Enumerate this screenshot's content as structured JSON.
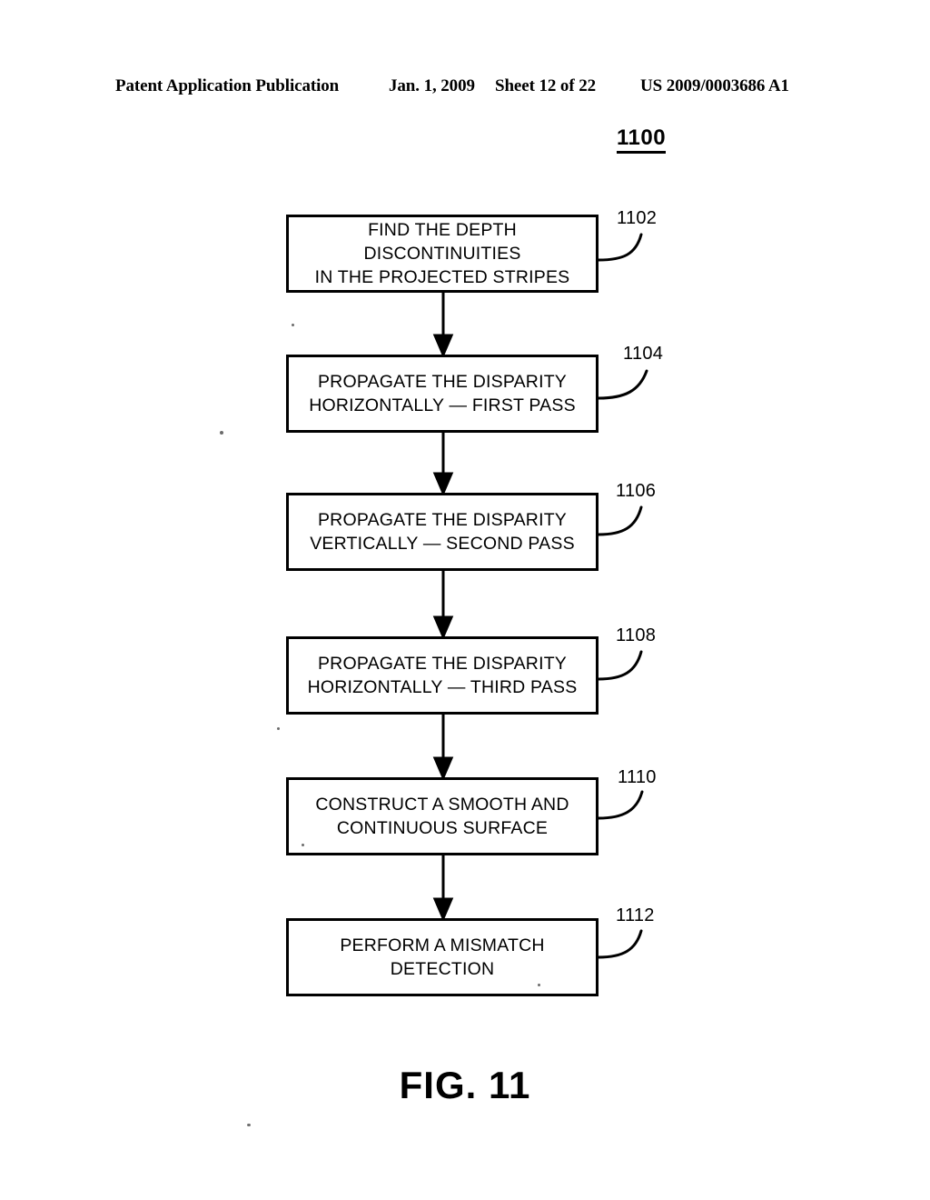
{
  "header": {
    "title": "Patent Application Publication",
    "date": "Jan. 1, 2009",
    "sheet": "Sheet 12 of 22",
    "patent_number": "US 2009/0003686 A1"
  },
  "figure": {
    "id": "1100",
    "caption": "FIG. 11"
  },
  "flowchart": {
    "steps": [
      {
        "ref": "1102",
        "text": "FIND THE DEPTH DISCONTINUITIES\nIN THE PROJECTED STRIPES"
      },
      {
        "ref": "1104",
        "text": "PROPAGATE THE DISPARITY\nHORIZONTALLY — FIRST PASS"
      },
      {
        "ref": "1106",
        "text": "PROPAGATE THE DISPARITY\nVERTICALLY — SECOND PASS"
      },
      {
        "ref": "1108",
        "text": "PROPAGATE THE DISPARITY\nHORIZONTALLY — THIRD PASS"
      },
      {
        "ref": "1110",
        "text": "CONSTRUCT A SMOOTH AND\nCONTINUOUS SURFACE"
      },
      {
        "ref": "1112",
        "text": "PERFORM A MISMATCH\nDETECTION"
      }
    ]
  },
  "colors": {
    "ink": "#000000",
    "page": "#ffffff"
  }
}
